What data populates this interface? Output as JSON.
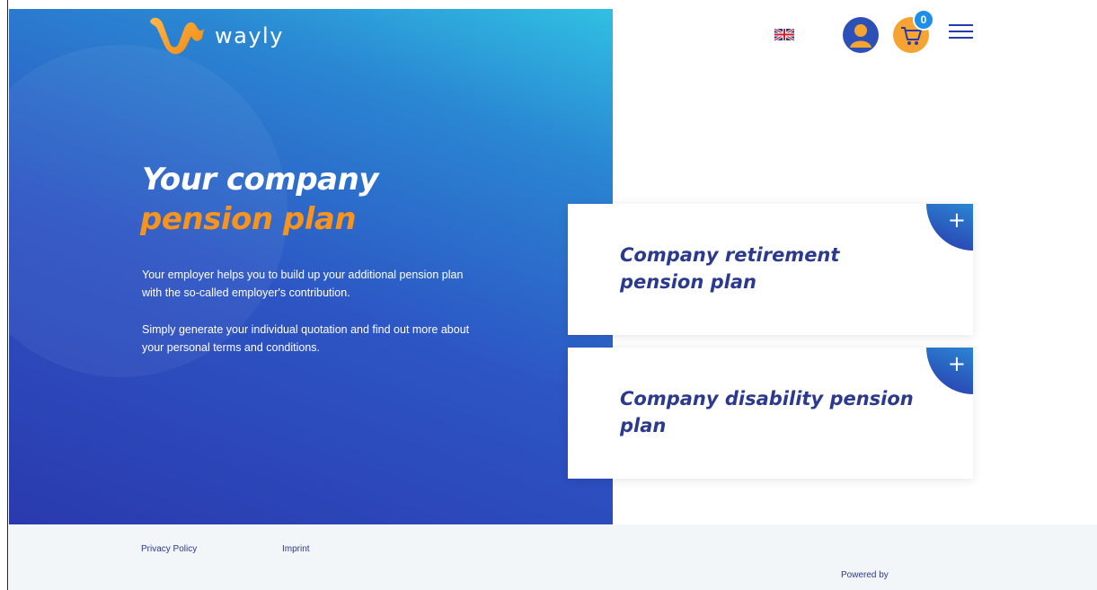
{
  "brand": {
    "name": "wayly"
  },
  "hero": {
    "title_line1": "Your company",
    "title_line2": "pension plan",
    "paragraph1": "Your employer helps you to build up your additional pension plan with the so-called employer's contribution.",
    "paragraph2": "Simply generate your individual quotation and find out more about your personal terms and conditions."
  },
  "header": {
    "language_icon": "uk-flag-icon",
    "user_icon": "user-avatar-icon",
    "cart_icon": "shopping-cart-icon",
    "cart_count": "0",
    "menu_icon": "hamburger-menu-icon"
  },
  "cards": [
    {
      "title": "Company retirement pension plan",
      "action": "+"
    },
    {
      "title": "Company disability pension plan",
      "action": "+"
    }
  ],
  "footer": {
    "privacy": "Privacy Policy",
    "imprint": "Imprint",
    "powered_by": "Powered by"
  },
  "colors": {
    "accent_orange": "#f7941d",
    "primary_blue": "#2a3aae",
    "hero_light_blue": "#30c0e2",
    "card_title": "#2b3a8f"
  }
}
